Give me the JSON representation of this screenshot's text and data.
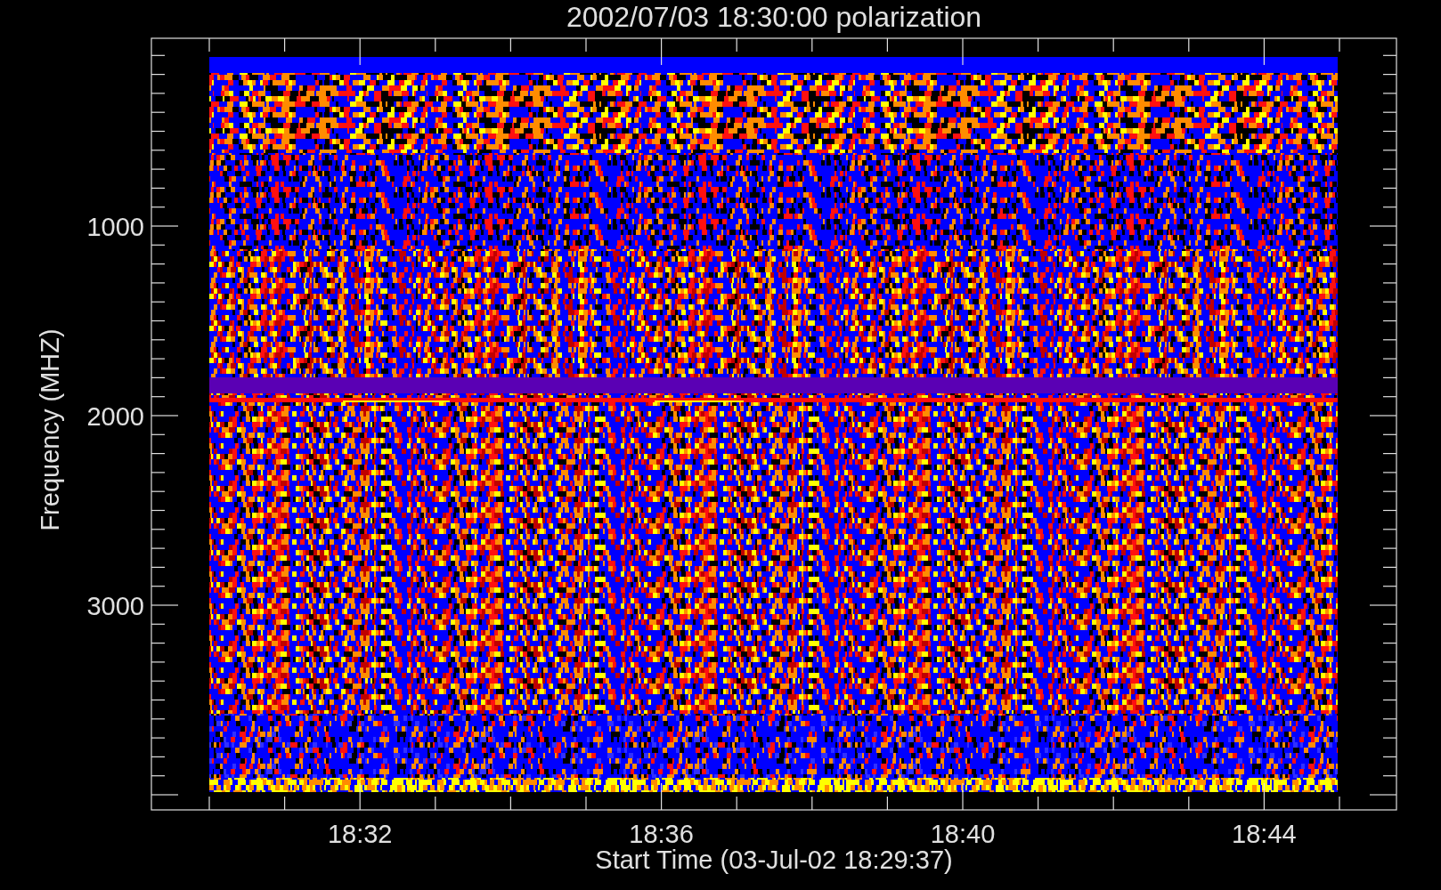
{
  "plot": {
    "title": "2002/07/03 18:30:00 polarization",
    "xlabel": "Start Time (03-Jul-02 18:29:37)",
    "ylabel": "Frequency (MHZ)",
    "x_tick_labels": [
      "18:32",
      "18:36",
      "18:40",
      "18:44"
    ],
    "y_tick_labels": [
      "1000",
      "2000",
      "3000"
    ]
  }
}
